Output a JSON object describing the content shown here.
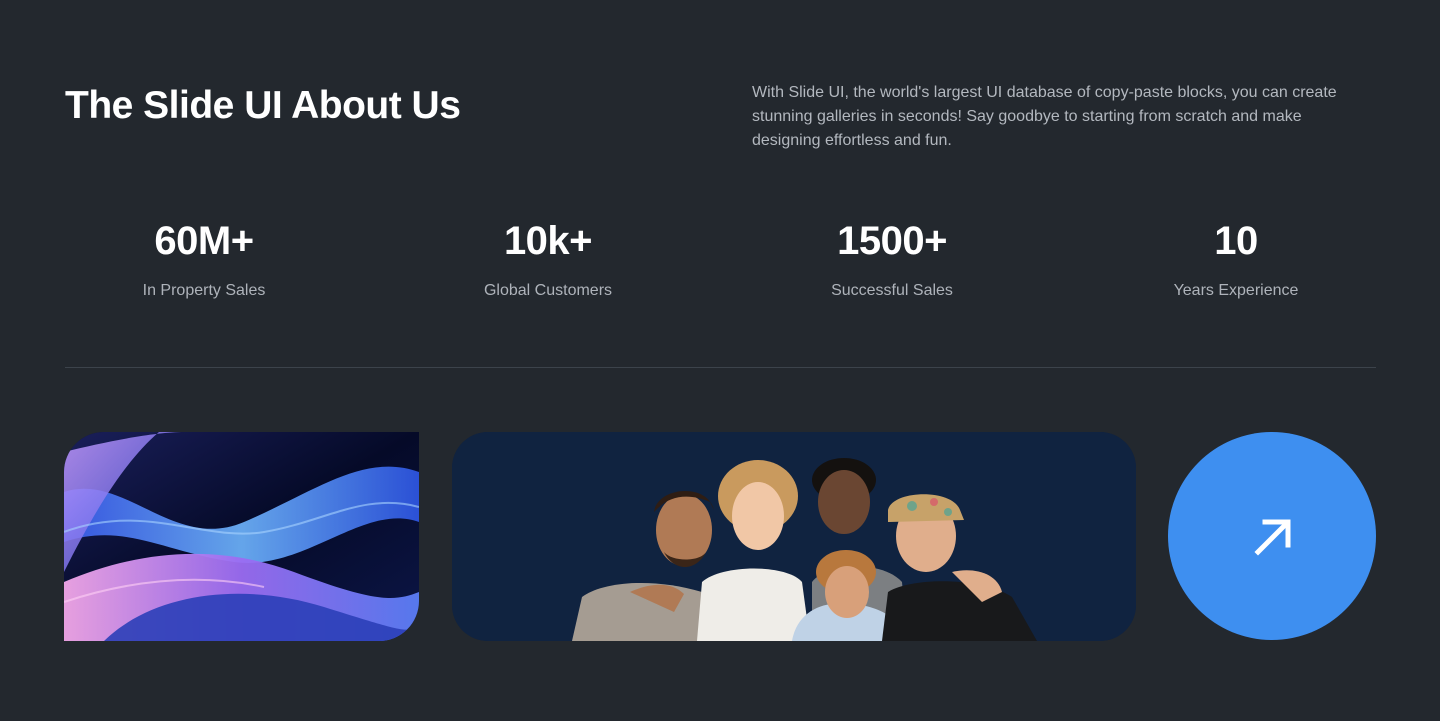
{
  "about": {
    "title": "The Slide UI About Us",
    "description": "With Slide UI, the world's largest UI database of copy-paste blocks, you can create stunning galleries in seconds! Say goodbye to starting from scratch and make designing effortless and fun."
  },
  "stats": [
    {
      "value": "60M+",
      "label": "In Property Sales"
    },
    {
      "value": "10k+",
      "label": "Global Customers"
    },
    {
      "value": "1500+",
      "label": "Successful Sales"
    },
    {
      "value": "10",
      "label": "Years Experience"
    }
  ],
  "gallery": {
    "arrow_button_icon": "arrow-up-right-icon",
    "accent_color": "#3e8ff0",
    "background_color": "#23282e"
  }
}
